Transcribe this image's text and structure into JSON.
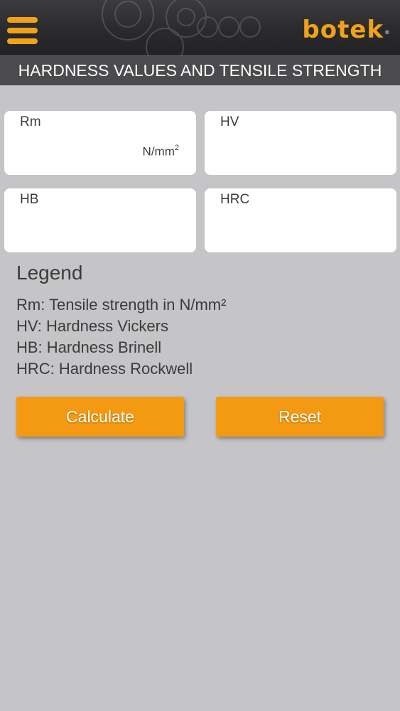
{
  "header": {
    "menu_icon": "hamburger-menu-icon",
    "brand": "botek",
    "brand_mark": "®",
    "brand_color": "#f2a119"
  },
  "page": {
    "title": "HARDNESS VALUES AND TENSILE STRENGTH"
  },
  "fields": {
    "rm": {
      "label": "Rm",
      "unit_base": "N/mm",
      "unit_exp": "2",
      "value": ""
    },
    "hv": {
      "label": "HV",
      "value": ""
    },
    "hb": {
      "label": "HB",
      "value": ""
    },
    "hrc": {
      "label": "HRC",
      "value": ""
    }
  },
  "legend": {
    "title": "Legend",
    "items": [
      "Rm: Tensile strength in N/mm²",
      "HV: Hardness Vickers",
      "HB: Hardness Brinell",
      "HRC: Hardness Rockwell"
    ]
  },
  "actions": {
    "calculate": "Calculate",
    "reset": "Reset",
    "button_color": "#f39a12"
  }
}
